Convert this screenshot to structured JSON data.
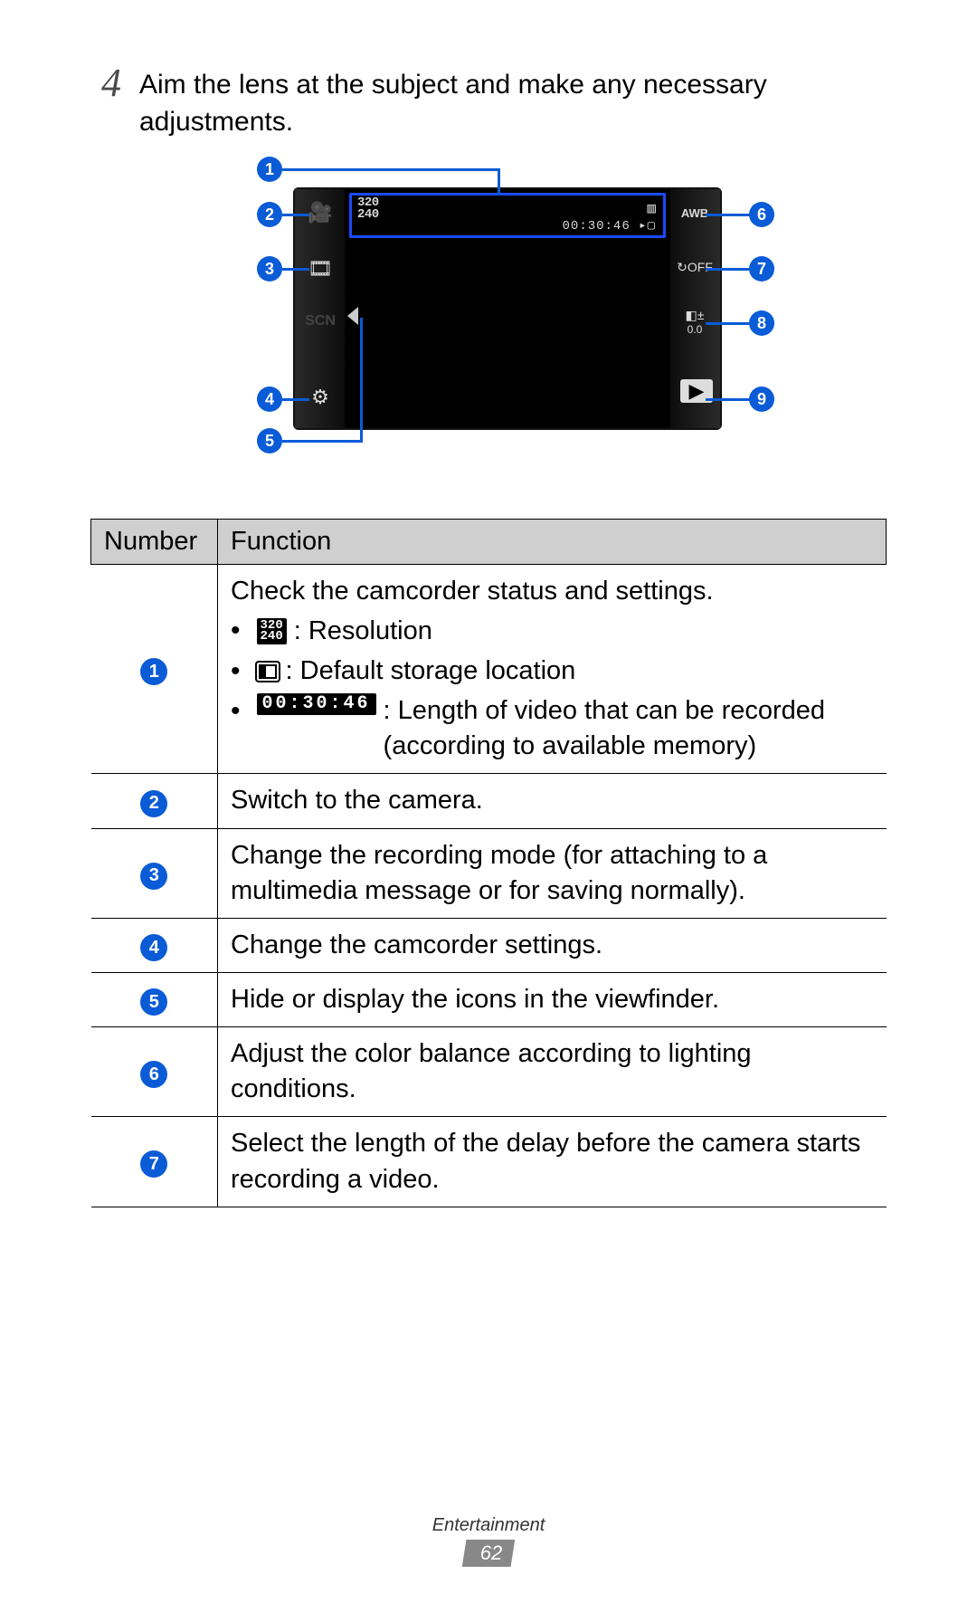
{
  "step": {
    "number": "4",
    "text": "Aim the lens at the subject and make any necessary adjustments."
  },
  "diagram": {
    "status": {
      "resolution_label": "320\n240",
      "time": "00:30:46",
      "storage_glyph": "▸▢"
    },
    "left_icons": {
      "camera": "🎥",
      "mode": "🎞",
      "scn": "SCN",
      "settings": "⚙"
    },
    "right_icons": {
      "awb": "AWB",
      "timer_off": "↻OFF",
      "exposure_icon": "◧±",
      "exposure_val": "0.0",
      "play": "▶"
    },
    "callouts": [
      "1",
      "2",
      "3",
      "4",
      "5",
      "6",
      "7",
      "8",
      "9"
    ]
  },
  "table": {
    "headers": {
      "number": "Number",
      "function": "Function"
    },
    "row1": {
      "badge": "1",
      "lead": "Check the camcorder status and settings.",
      "res_icon": "320\n240",
      "res_label": ": Resolution",
      "store_label": ": Default storage location",
      "time_icon": "00:30:46",
      "time_label": ": Length of video that can be recorded (according to available memory)"
    },
    "row2": {
      "badge": "2",
      "text": "Switch to the camera."
    },
    "row3": {
      "badge": "3",
      "text": "Change the recording mode (for attaching to a multimedia message or for saving normally)."
    },
    "row4": {
      "badge": "4",
      "text": "Change the camcorder settings."
    },
    "row5": {
      "badge": "5",
      "text": "Hide or display the icons in the viewfinder."
    },
    "row6": {
      "badge": "6",
      "text": "Adjust the color balance according to lighting conditions."
    },
    "row7": {
      "badge": "7",
      "text": "Select the length of the delay before the camera starts recording a video."
    }
  },
  "footer": {
    "section": "Entertainment",
    "page": "62"
  }
}
